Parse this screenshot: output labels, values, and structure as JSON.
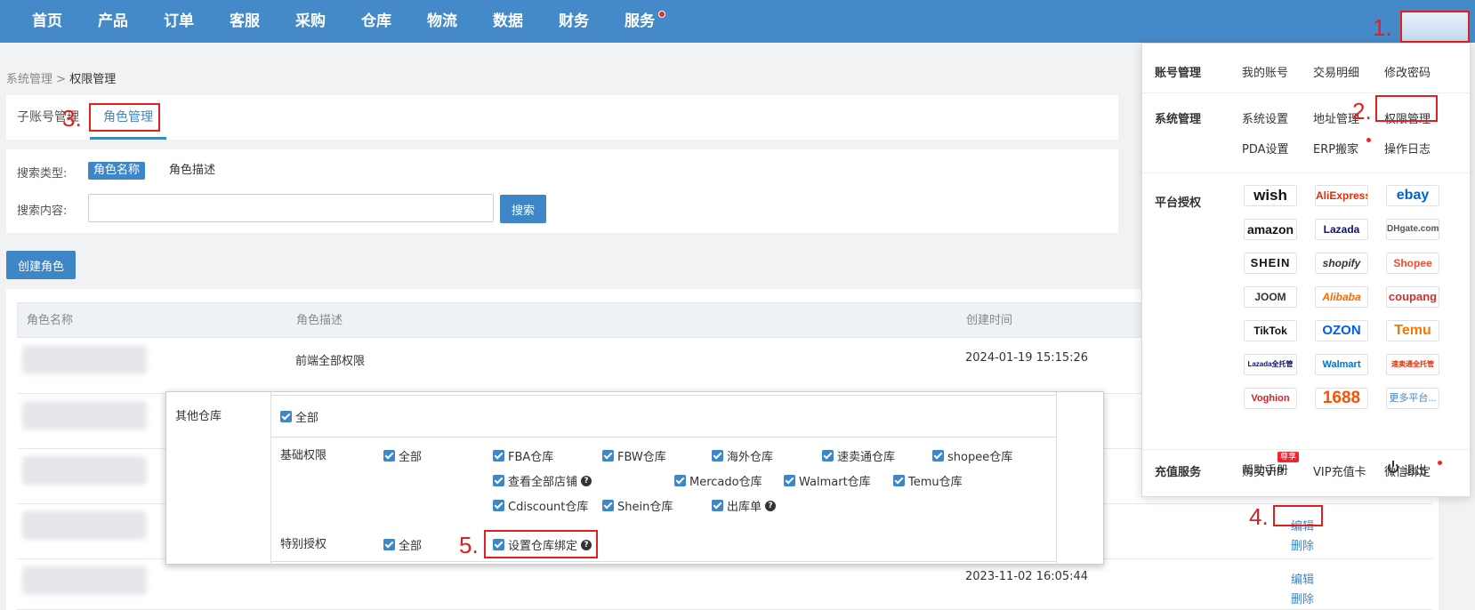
{
  "nav": {
    "items": [
      "首页",
      "产品",
      "订单",
      "客服",
      "采购",
      "仓库",
      "物流",
      "数据",
      "财务",
      "服务"
    ]
  },
  "annotations": [
    "1.",
    "2.",
    "3.",
    "4.",
    "5."
  ],
  "breadcrumb": {
    "parent": "系统管理",
    "separator": ">",
    "current": "权限管理"
  },
  "tabs": {
    "sub_accounts": "子账号管理",
    "roles": "角色管理"
  },
  "search": {
    "type_label": "搜索类型:",
    "type_options": [
      "角色名称",
      "角色描述"
    ],
    "content_label": "搜索内容:",
    "input_value": "",
    "button": "搜索"
  },
  "create_button": "创建角色",
  "table": {
    "headers": [
      "角色名称",
      "角色描述",
      "创建时间"
    ],
    "rows": [
      {
        "desc": "前端全部权限",
        "created": "2024-01-19 15:15:26"
      },
      {
        "desc": "",
        "created": "2023-11-02 16:05:44"
      }
    ],
    "actions": {
      "edit": "编辑",
      "delete": "删除"
    }
  },
  "menu": {
    "account": {
      "title": "账号管理",
      "items": [
        "我的账号",
        "交易明细",
        "修改密码"
      ]
    },
    "system": {
      "title": "系统管理",
      "items": [
        "系统设置",
        "地址管理",
        "权限管理",
        "PDA设置",
        "ERP搬家",
        "操作日志"
      ]
    },
    "platforms": {
      "title": "平台授权",
      "logos": [
        "wish",
        "AliExpress",
        "ebay",
        "amazon",
        "Lazada",
        "DHgate.com",
        "SHEIN",
        "shopify",
        "Shopee",
        "JOOM",
        "Alibaba",
        "coupang",
        "TikTok",
        "OZON",
        "Temu",
        "Lazada全托管",
        "Walmart",
        "速卖通全托管",
        "Voghion",
        "1688",
        "更多平台..."
      ]
    },
    "recharge": {
      "title": "充值服务",
      "items": [
        "购买VIP",
        "VIP充值卡",
        "微信绑定"
      ],
      "badge": "尊享"
    },
    "footer": {
      "help": "帮助手册",
      "logout": "退出"
    }
  },
  "permissions": {
    "other_warehouse": {
      "label": "其他仓库",
      "all": "全部"
    },
    "basic": {
      "label": "基础权限",
      "all": "全部",
      "items": [
        "FBA仓库",
        "FBW仓库",
        "海外仓库",
        "速卖通仓库",
        "shopee仓库",
        "查看全部店铺",
        "Mercado仓库",
        "Walmart仓库",
        "Temu仓库",
        "Cdiscount仓库",
        "Shein仓库",
        "出库单"
      ]
    },
    "special": {
      "label": "特别授权",
      "all": "全部",
      "items": [
        "设置仓库绑定"
      ]
    },
    "help_mark": "?"
  },
  "colors": {
    "nav_bg": "#4489c8",
    "primary": "#3f86c7",
    "annotation": "#e02020"
  }
}
